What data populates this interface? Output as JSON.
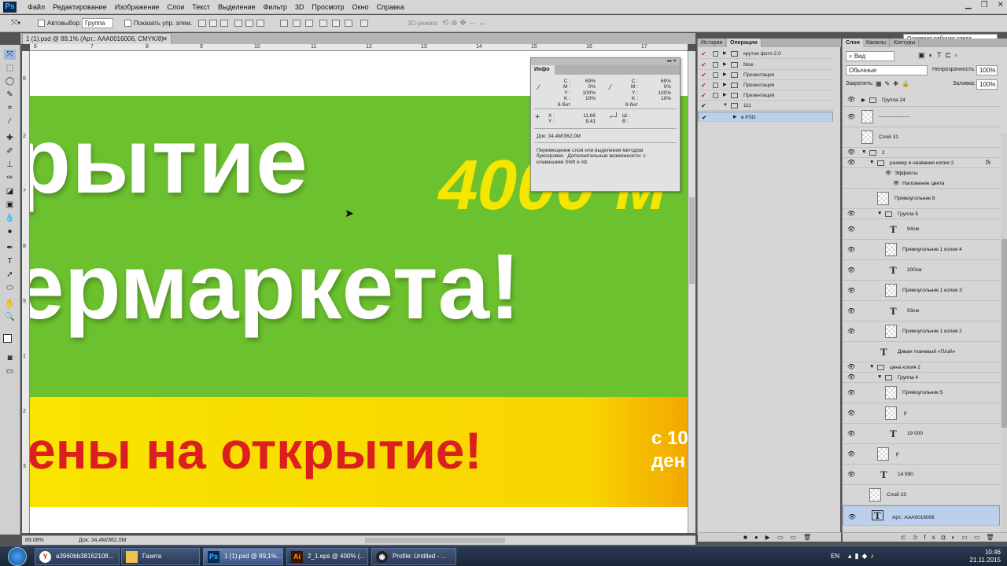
{
  "app": {
    "logo": "Ps"
  },
  "menu": [
    "Файл",
    "Редактирование",
    "Изображение",
    "Слои",
    "Текст",
    "Выделение",
    "Фильтр",
    "3D",
    "Просмотр",
    "Окно",
    "Справка"
  ],
  "options": {
    "autoselect_label": "Автовыбор:",
    "autoselect_value": "Группа",
    "show_controls": "Показать упр. элем.",
    "mode3d": "3D-режим:",
    "workspace": "Основная рабочая среда"
  },
  "document": {
    "tab_title": "1 (1).psd @ 89,1% (Арт.: AAA0016006, CMYK/8)",
    "zoom": "89.08%",
    "doc_size": "Док: 34,4M/362,0M"
  },
  "ruler_top": [
    "6",
    "7",
    "8",
    "9",
    "10",
    "11",
    "12",
    "13",
    "14",
    "15",
    "16",
    "17"
  ],
  "ruler_left": [
    "6",
    "2",
    "7",
    "8",
    "9",
    "1",
    "2",
    "3"
  ],
  "canvas": {
    "line1": "рытие",
    "line1_yellow": "4000 м",
    "line2": "ермаркета!",
    "line3": "ены на открытие!",
    "side_text": "с 10\nден"
  },
  "info_panel": {
    "title": "Инфо",
    "cmyk_left": "C :\nM :\nY :\nK :\n8-бит",
    "cmyk_left_vals": "69%\n0%\n100%\n10%",
    "cmyk_right": "C :\nM :\nY :\nK :\n8-бит",
    "cmyk_right_vals": "69%\n0%\n100%\n10%",
    "xy": "X :\nY :",
    "xy_vals": "11,66\n8,41",
    "wh": "Ш :\nВ :",
    "doc": "Док: 34,4M/362,0M",
    "hint": "Перемещение слоя или выделения методом\nбуксировки.  Дополнительные возможности: с\nклавишами Shift и Alt."
  },
  "mid_panel": {
    "tabs": [
      "История",
      "Операции"
    ],
    "actions": [
      {
        "label": "крутое фото 2.0",
        "check": "✔"
      },
      {
        "label": "Мое",
        "check": "✔"
      },
      {
        "label": "Презентация",
        "check": "✔"
      },
      {
        "label": "Презентация",
        "check": "✔"
      },
      {
        "label": "Презентация",
        "check": "✔"
      },
      {
        "label": "111",
        "check": "✔"
      },
      {
        "label": "в PSD",
        "check": "✔"
      }
    ]
  },
  "right_panel": {
    "tabs": [
      "Слои",
      "Каналы",
      "Контуры"
    ],
    "kind": "Вид",
    "blend": "Обычные",
    "opacity_label": "Непрозрачность:",
    "opacity": "100%",
    "lock_label": "Закрепить:",
    "fill_label": "Заливка:",
    "fill": "100%",
    "layers": [
      "Группа 24",
      "------------------",
      "Слой 31",
      "2",
      "размер и названия копия 2",
      "Эффекты",
      "Наложение цвета",
      "Прямоугольник 8",
      "Группа 5",
      "94см",
      "Прямоугольник 1 копия 4",
      "200см",
      "Прямоугольник 1 копия 3",
      "93см",
      "Прямоугольник 1 копия 2",
      "Диван тканевый «Плэй»",
      "цена копия 2",
      "Группа 4",
      "Прямоугольник 5",
      "р",
      "19 000",
      "р",
      "14 990",
      "Слой 23",
      "Арт.: AAA0016006"
    ],
    "fx": "fx"
  },
  "taskbar": {
    "items": [
      "a3960bb38162108...",
      "Газета",
      "1 (1).psd @ 89,1%...",
      "2_1.eps @ 400% (...",
      "Profile: Untitled - ..."
    ],
    "lang": "EN",
    "time": "10:46",
    "date": "21.11.2015"
  }
}
